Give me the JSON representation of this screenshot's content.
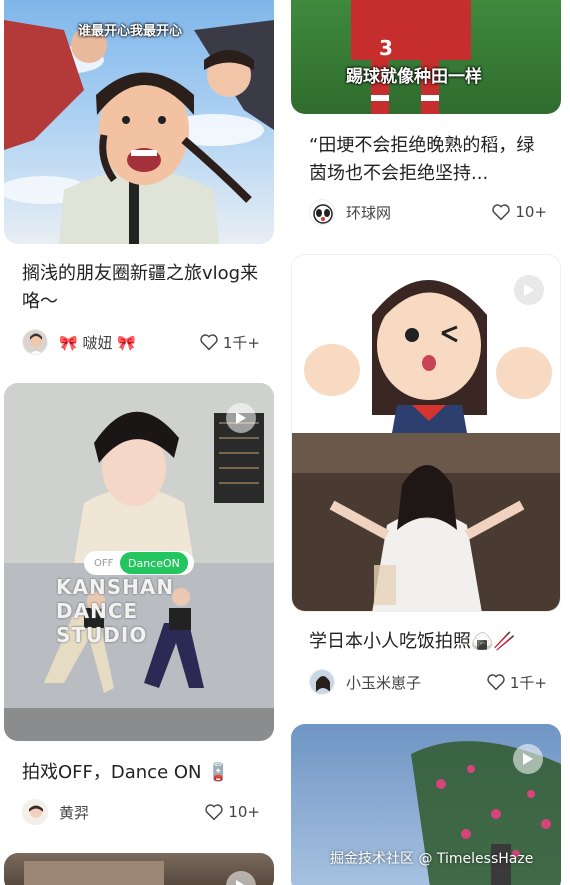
{
  "feed": {
    "left": [
      {
        "overlay_text": "谁最开心我最开心",
        "title": "搁浅的朋友圈新疆之旅vlog来咯～",
        "author": "🎀 啵妞 🎀",
        "likes": "1千+",
        "has_play": false
      },
      {
        "overlay_text": "KANSHAN DANCE STUDIO",
        "toggle_off": "OFF",
        "toggle_on": "DanceON",
        "title": "拍戏OFF，Dance ON 🪫",
        "author": "黄羿",
        "likes": "10+",
        "has_play": true
      }
    ],
    "right": [
      {
        "overlay_text": "踢球就像种田一样",
        "title": "“田埂不会拒绝晚熟的稻，绿茵场也不会拒绝坚持...",
        "author": "环球网",
        "likes": "10+",
        "has_play": false
      },
      {
        "title": "学日本小人吃饭拍照🍙🥢",
        "author": "小玉米崽子",
        "likes": "1千+",
        "has_play": true
      },
      {
        "has_play": true
      }
    ]
  },
  "watermark": "掘金技术社区 @ TimelessHaze",
  "colors": {
    "green": "#22c55e",
    "text": "#222222",
    "meta": "#444444"
  }
}
